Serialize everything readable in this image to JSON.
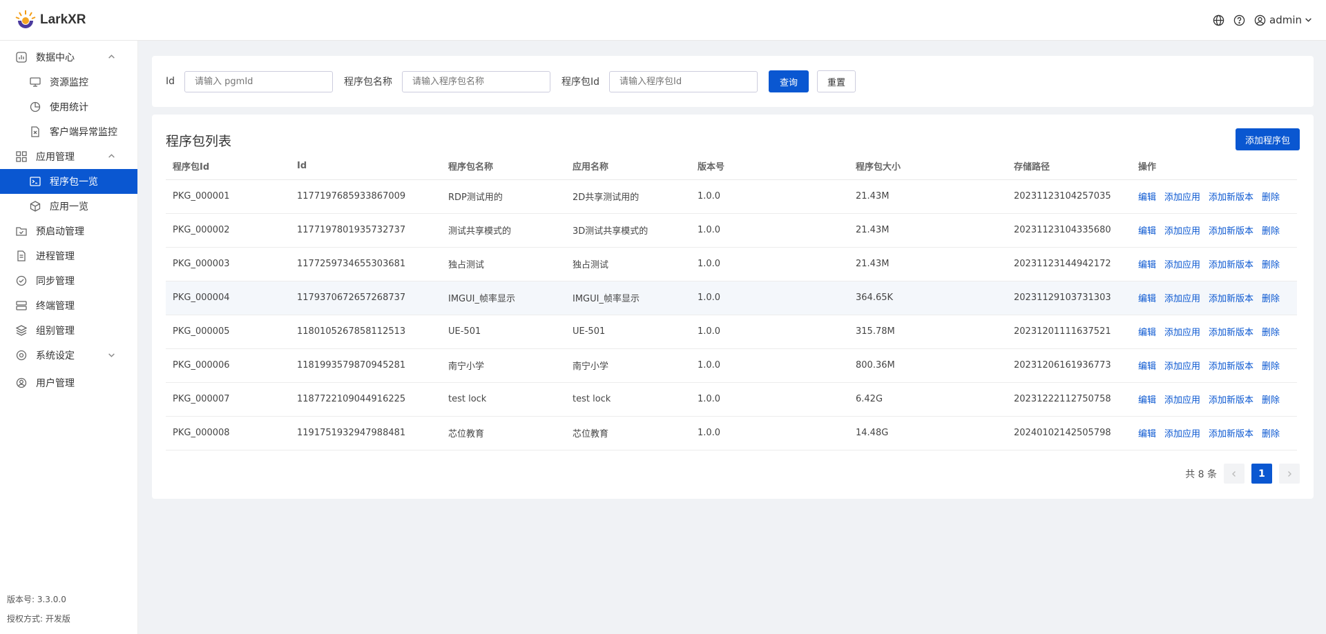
{
  "app": {
    "brand": "LarkXR"
  },
  "header": {
    "user": "admin"
  },
  "sidebar": {
    "groups": [
      {
        "label": "数据中心",
        "items": [
          "资源监控",
          "使用统计",
          "客户端异常监控"
        ]
      },
      {
        "label": "应用管理",
        "items": [
          "程序包一览",
          "应用一览"
        ]
      }
    ],
    "items": [
      "预启动管理",
      "进程管理",
      "同步管理",
      "终端管理",
      "组别管理",
      "系统设定",
      "用户管理"
    ],
    "footer": {
      "version": "版本号: 3.3.0.0",
      "license": "授权方式: 开发版"
    }
  },
  "filter": {
    "id_label": "Id",
    "id_placeholder": "请输入 pgmId",
    "name_label": "程序包名称",
    "name_placeholder": "请输入程序包名称",
    "pkg_label": "程序包Id",
    "pkg_placeholder": "请输入程序包Id",
    "search_label": "查询",
    "reset_label": "重置"
  },
  "list": {
    "title": "程序包列表",
    "add_label": "添加程序包",
    "columns": [
      "程序包Id",
      "Id",
      "程序包名称",
      "应用名称",
      "版本号",
      "程序包大小",
      "存储路径",
      "操作"
    ],
    "ops": [
      "编辑",
      "添加应用",
      "添加新版本",
      "删除"
    ],
    "rows": [
      [
        "PKG_000001",
        "1177197685933867009",
        "RDP测试用的",
        "2D共享测试用的",
        "1.0.0",
        "21.43M",
        "20231123104257035"
      ],
      [
        "PKG_000002",
        "1177197801935732737",
        "测试共享模式的",
        "3D测试共享模式的",
        "1.0.0",
        "21.43M",
        "20231123104335680"
      ],
      [
        "PKG_000003",
        "1177259734655303681",
        "独占测试",
        "独占测试",
        "1.0.0",
        "21.43M",
        "20231123144942172"
      ],
      [
        "PKG_000004",
        "1179370672657268737",
        "IMGUI_帧率显示",
        "IMGUI_帧率显示",
        "1.0.0",
        "364.65K",
        "20231129103731303"
      ],
      [
        "PKG_000005",
        "1180105267858112513",
        "UE-501",
        "UE-501",
        "1.0.0",
        "315.78M",
        "20231201111637521"
      ],
      [
        "PKG_000006",
        "1181993579870945281",
        "南宁小学",
        "南宁小学",
        "1.0.0",
        "800.36M",
        "20231206161936773"
      ],
      [
        "PKG_000007",
        "1187722109044916225",
        "test lock",
        "test lock",
        "1.0.0",
        "6.42G",
        "20231222112750758"
      ],
      [
        "PKG_000008",
        "1191751932947988481",
        "芯位教育",
        "芯位教育",
        "1.0.0",
        "14.48G",
        "20240102142505798"
      ]
    ]
  },
  "pager": {
    "total": "共 8 条",
    "current": "1"
  },
  "colors": {
    "primary": "#0a57d1"
  }
}
